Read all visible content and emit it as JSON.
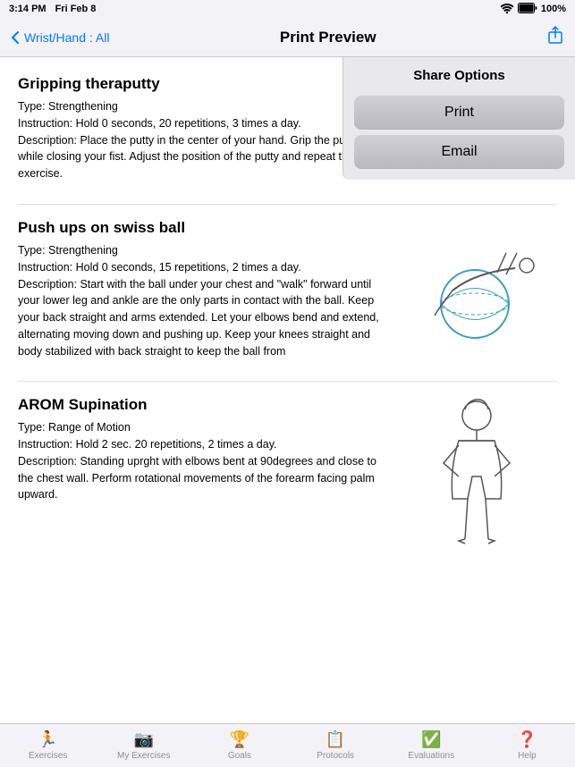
{
  "statusBar": {
    "time": "3:14 PM",
    "date": "Fri Feb 8",
    "wifi": "WiFi",
    "battery": "100%"
  },
  "navBar": {
    "backLabel": "Wrist/Hand : All",
    "title": "Print Preview",
    "actionIcon": "share-icon"
  },
  "sharePanel": {
    "title": "Share Options",
    "printLabel": "Print",
    "emailLabel": "Email"
  },
  "exercises": [
    {
      "title": "Gripping theraputty",
      "type": "Type: Strengthening",
      "instruction": "Instruction: Hold 0 seconds, 20 repetitions, 3 times a day.",
      "description": "Description: Place the putty in the center of your hand. Grip the putty firmly while closing your fist. Adjust the position of the putty and repeat the exercise."
    },
    {
      "title": "Push ups on swiss ball",
      "type": "Type: Strengthening",
      "instruction": "Instruction: Hold 0 seconds, 15 repetitions, 2 times a day.",
      "description": "Description: Start with the ball under your chest and \"walk\" forward until your lower leg and ankle are the only parts in contact with the ball. Keep your back straight and arms extended. Let your elbows bend and extend, alternating moving down and pushing up. Keep your knees straight and body stabilized with back straight to keep the ball from"
    },
    {
      "title": "AROM Supination",
      "type": "Type: Range of Motion",
      "instruction": "Instruction: Hold 2 sec. 20 repetitions, 2 times a day.",
      "description": "Description: Standing uprght with elbows bent at 90degrees and close to the chest wall. Perform rotational movements of the forearm facing palm upward."
    }
  ],
  "tabs": [
    {
      "id": "exercises",
      "label": "Exercises",
      "icon": "run-icon"
    },
    {
      "id": "my-exercises",
      "label": "My Exercises",
      "icon": "camera-icon"
    },
    {
      "id": "goals",
      "label": "Goals",
      "icon": "trophy-icon"
    },
    {
      "id": "protocols",
      "label": "Protocols",
      "icon": "list-icon"
    },
    {
      "id": "evaluations",
      "label": "Evaluations",
      "icon": "check-icon"
    },
    {
      "id": "help",
      "label": "Help",
      "icon": "question-icon"
    }
  ]
}
